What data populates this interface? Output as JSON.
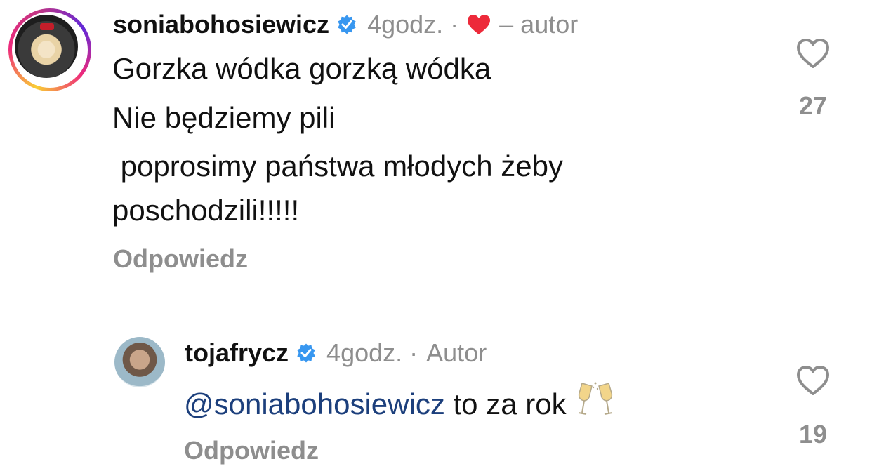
{
  "comments": [
    {
      "username": "soniabohosiewicz",
      "time": "4godz.",
      "separator": "·",
      "author_tag": "– autor",
      "lines": [
        "Gorzka wódka gorzką wódka",
        "Nie będziemy pili",
        " poprosimy państwa młodych żeby",
        "poschodzili!!!!!"
      ],
      "reply_label": "Odpowiedz",
      "like_count": "27",
      "liked_by_author": true,
      "avatar_has_story_ring": true
    },
    {
      "username": "tojafrycz",
      "time": "4godz.",
      "separator": "·",
      "author_tag": "Autor",
      "mention": "@soniabohosiewicz",
      "text": "to za rok",
      "emoji": "clinking-glasses",
      "reply_label": "Odpowiedz",
      "like_count": "19"
    }
  ],
  "colors": {
    "verified": "#3897f0",
    "heart": "#ed2a3a",
    "mention": "#1c3f7c",
    "muted": "#8e8e8e"
  }
}
